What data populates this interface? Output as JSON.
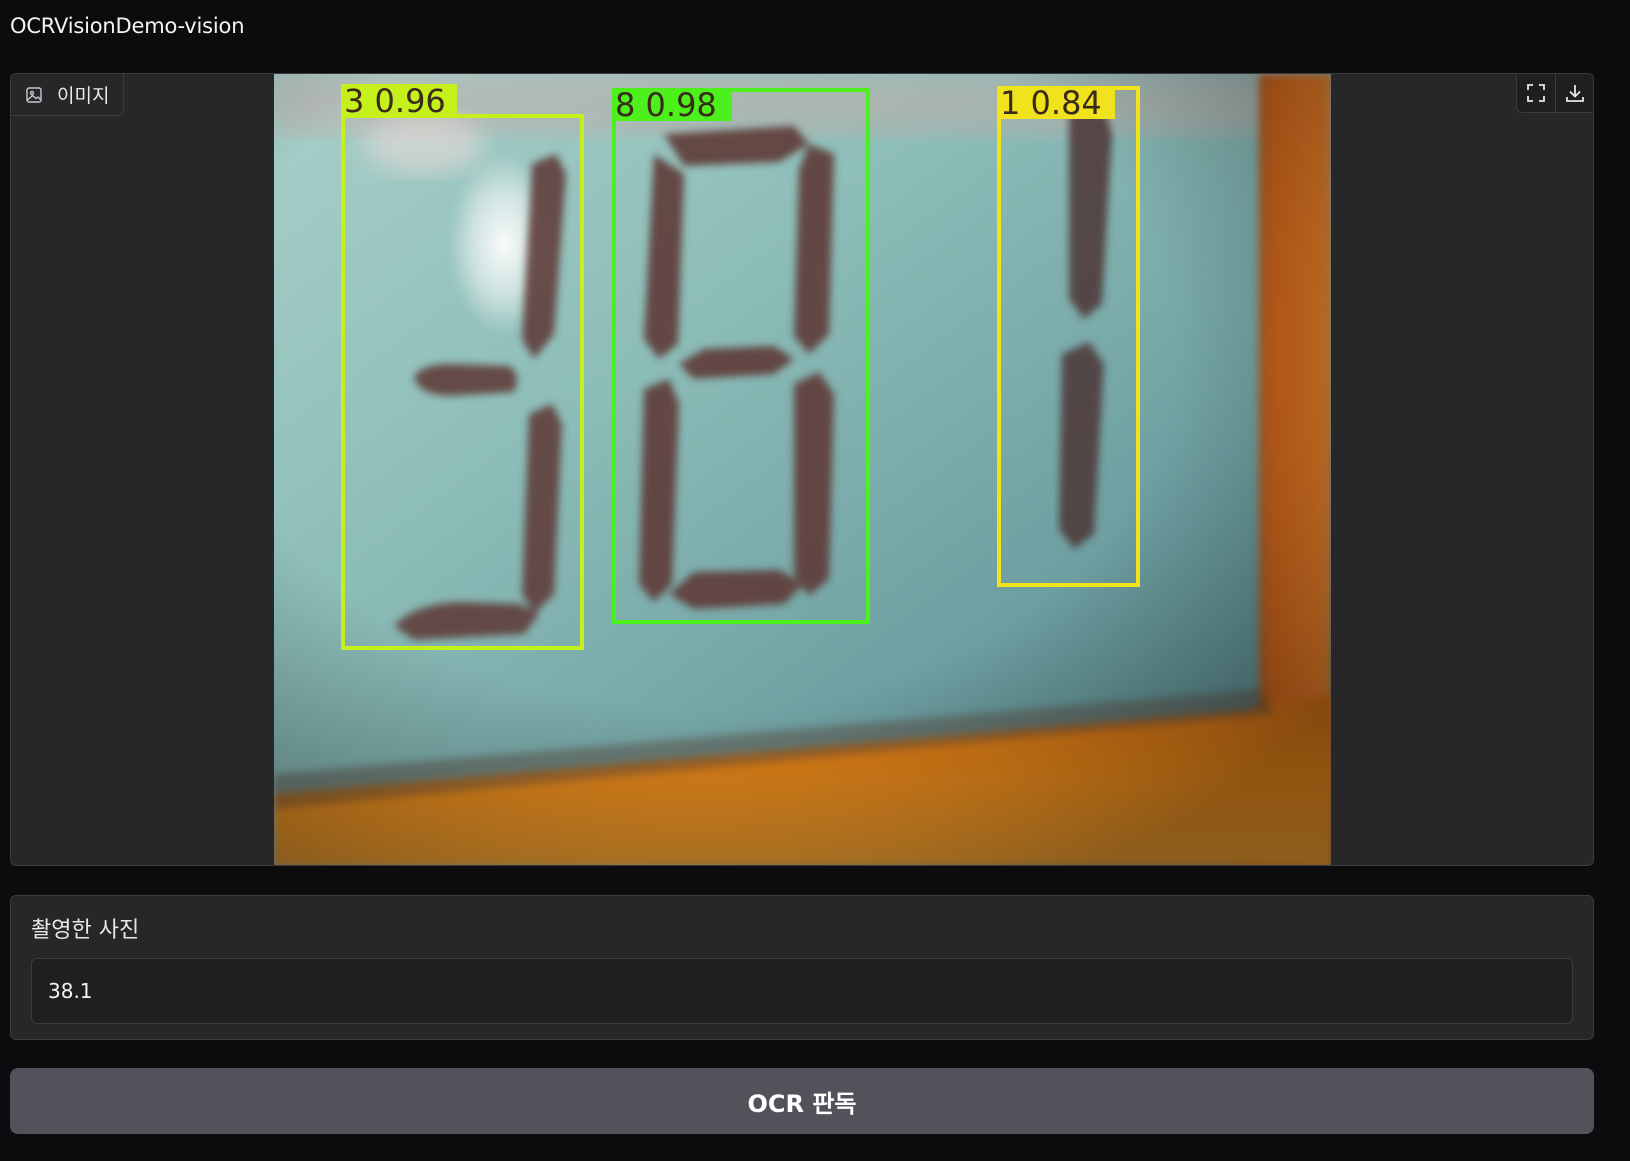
{
  "app": {
    "title": "OCRVisionDemo-vision"
  },
  "image_panel": {
    "label": "이미지",
    "label_icon": "image-icon",
    "buttons": [
      {
        "icon": "fullscreen-icon"
      },
      {
        "icon": "download-icon"
      }
    ],
    "detections": [
      {
        "label": "3 0.96",
        "color": "#c6f01c"
      },
      {
        "label": "8 0.98",
        "color": "#4cf01c"
      },
      {
        "label": "1 0.84",
        "color": "#f0e21c"
      }
    ]
  },
  "result": {
    "label": "촬영한 사진",
    "value": "38.1"
  },
  "actions": {
    "ocr_label": "OCR 판독"
  },
  "colors": {
    "background": "#0c0c0f",
    "panel": "#27272a",
    "border": "#3a3a3f",
    "button": "#52525b"
  }
}
